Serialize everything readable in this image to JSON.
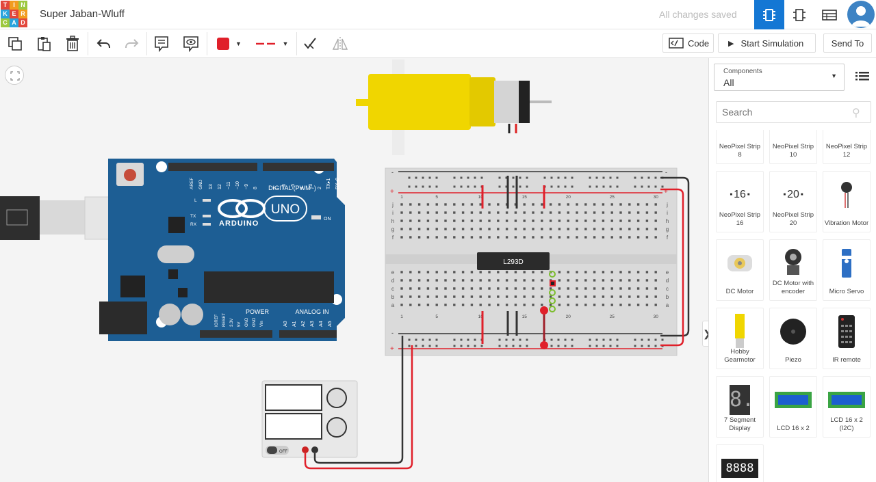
{
  "app": {
    "title": "Super Jaban-Wluff",
    "save_status": "All changes saved",
    "logo_letters": [
      "T",
      "I",
      "N",
      "K",
      "E",
      "R",
      "C",
      "A",
      "D"
    ],
    "colors": {
      "active_tab": "#1477d4",
      "arduino": "#1d5e94",
      "motor": "#f0d600"
    }
  },
  "topbar": {
    "icons": [
      "circuit-view-icon",
      "schematic-view-icon",
      "component-list-icon"
    ]
  },
  "toolbar": {
    "copy": "copy-icon",
    "paste": "paste-icon",
    "delete": "delete-icon",
    "undo": "undo-icon",
    "redo": "redo-icon",
    "note": "note-icon",
    "notes_toggle": "notes-toggle-icon",
    "wire_color": "#e0202a",
    "code_label": "Code",
    "simulate_label": "Start Simulation",
    "send_label": "Send To"
  },
  "panel": {
    "components_label": "Components",
    "components_value": "All",
    "search_placeholder": "Search",
    "tiles": [
      {
        "label": "NeoPixel Strip 8"
      },
      {
        "label": "NeoPixel Strip 10"
      },
      {
        "label": "NeoPixel Strip 12"
      },
      {
        "label": "NeoPixel Strip 16",
        "glyph": "16"
      },
      {
        "label": "NeoPixel Strip 20",
        "glyph": "20"
      },
      {
        "label": "Vibration Motor"
      },
      {
        "label": "DC Motor"
      },
      {
        "label": "DC Motor with encoder"
      },
      {
        "label": "Micro Servo"
      },
      {
        "label": "Hobby Gearmotor"
      },
      {
        "label": "Piezo"
      },
      {
        "label": "IR remote"
      },
      {
        "label": "7 Segment Display",
        "glyph": "8."
      },
      {
        "label": "LCD 16 x 2"
      },
      {
        "label": "LCD 16 x 2 (I2C)"
      },
      {
        "label": "",
        "glyph": "8888"
      }
    ]
  },
  "canvas": {
    "arduino": {
      "brand": "ARDUINO",
      "model": "UNO",
      "digital_label": "DIGITAL (PWM~)",
      "power_label": "POWER",
      "analog_label": "ANALOG IN",
      "on_label": "ON",
      "aref": "AREF",
      "gnd": "GND",
      "tx": "TX",
      "rx": "RX",
      "l": "L",
      "pins_digital": [
        "13",
        "12",
        "~11",
        "~10",
        "~9",
        "8",
        "7",
        "~6",
        "~5",
        "4",
        "~3",
        "2",
        "TX▸1",
        "RX◂0"
      ],
      "pins_power": [
        "IOREF",
        "RESET",
        "3.3V",
        "5V",
        "GND",
        "GND",
        "Vin"
      ],
      "pins_analog": [
        "A0",
        "A1",
        "A2",
        "A3",
        "A4",
        "A5"
      ]
    },
    "breadboard": {
      "chip_label": "L293D",
      "col_numbers": [
        "1",
        "5",
        "10",
        "15",
        "20",
        "25",
        "30"
      ],
      "rows_top": [
        "j",
        "i",
        "h",
        "g",
        "f"
      ],
      "rows_bottom": [
        "e",
        "d",
        "c",
        "b",
        "a"
      ]
    },
    "power_supply": {
      "off_label": "OFF"
    }
  }
}
